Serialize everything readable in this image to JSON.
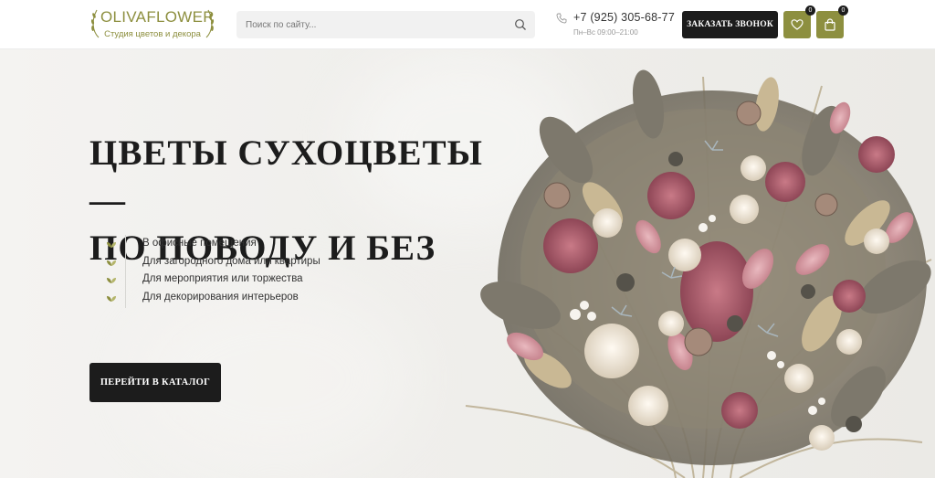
{
  "header": {
    "logo": {
      "name": "OLIVAFLOWER",
      "subtitle": "Студия цветов и декора"
    },
    "search": {
      "placeholder": "Поиск по сайту..."
    },
    "contact": {
      "phone": "+7 (925) 305-68-77",
      "hours": "Пн–Вс 09:00–21:00"
    },
    "callback_label": "ЗАКАЗАТЬ ЗВОНОК",
    "wishlist_count": "0",
    "cart_count": "0"
  },
  "hero": {
    "title_line1": "ЦВЕТЫ СУХОЦВЕТЫ —",
    "title_line2": "ПО ПОВОДУ И БЕЗ",
    "features": [
      "В офисные помещения",
      "Для загородного дома или квартиры",
      "Для мероприятия или торжества",
      "Для декорирования интерьеров"
    ],
    "catalog_label": "ПЕРЕЙТИ В КАТАЛОГ"
  },
  "colors": {
    "accent": "#8d8f3f",
    "dark": "#1c1c1c",
    "hero_bg": "#f0efec"
  },
  "icons": [
    "laurel-icon",
    "search-icon",
    "phone-icon",
    "heart-icon",
    "bag-icon",
    "leaf-icon"
  ]
}
